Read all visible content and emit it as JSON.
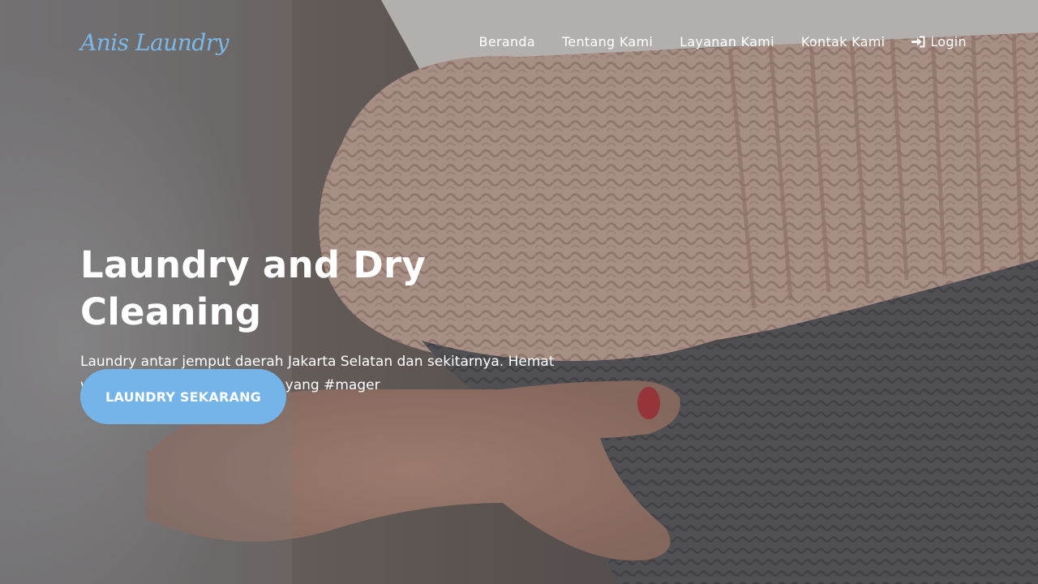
{
  "navbar": {
    "brand": "Anis Laundry",
    "links": [
      {
        "label": "Beranda"
      },
      {
        "label": "Tentang Kami"
      },
      {
        "label": "Layanan Kami"
      },
      {
        "label": "Kontak Kami"
      },
      {
        "label": "Login",
        "icon": "sign-in-icon"
      }
    ]
  },
  "hero": {
    "title": "Laundry and Dry Cleaning",
    "subtitle": "Laundry antar jemput daerah Jakarta Selatan dan sekitarnya. Hemat waktu dan simpel buat kamu yang #mager",
    "cta_label": "LAUNDRY SEKARANG",
    "background_image": "folded-sweaters-photo"
  },
  "colors": {
    "accent": "#74b4e8",
    "brand": "#7ab8ea",
    "text": "#ffffff"
  }
}
